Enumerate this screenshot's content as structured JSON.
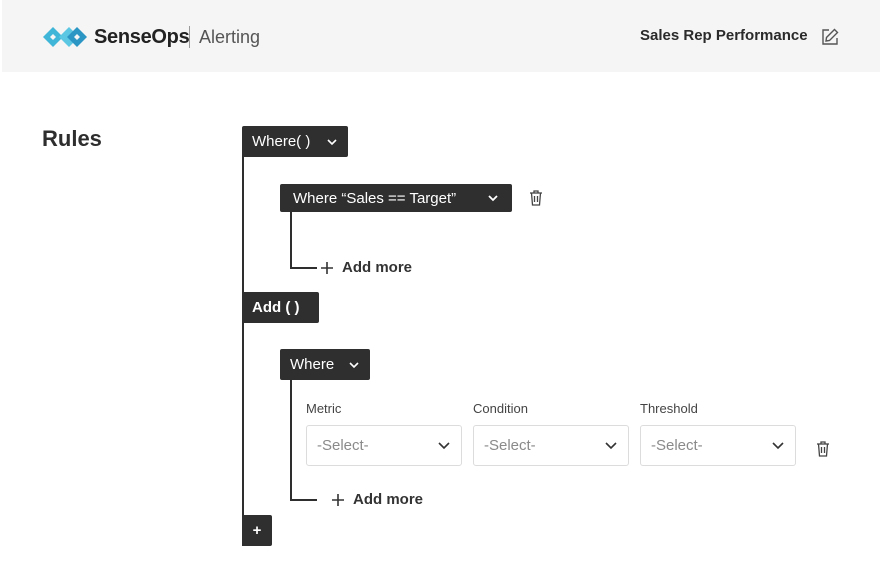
{
  "header": {
    "brand": "SenseOps",
    "product": "Alerting",
    "report_title": "Sales Rep Performance",
    "logo_colors": [
      "#3fb6d8",
      "#2b96c4"
    ]
  },
  "rules": {
    "title": "Rules",
    "where_group": {
      "label": "Where( )",
      "condition": {
        "label": "Where “Sales == Target”"
      },
      "add_more": "Add more"
    },
    "add_group": {
      "label": "Add ( )",
      "where": {
        "label": "Where"
      },
      "fields": [
        {
          "label": "Metric",
          "placeholder": "-Select-"
        },
        {
          "label": "Condition",
          "placeholder": "-Select-"
        },
        {
          "label": "Threshold",
          "placeholder": "-Select-"
        }
      ],
      "add_more": "Add more"
    },
    "add_button": "+"
  },
  "icons": {
    "edit": "edit-icon",
    "chevron": "chevron-down-icon",
    "trash": "trash-icon",
    "plus": "plus-icon"
  }
}
